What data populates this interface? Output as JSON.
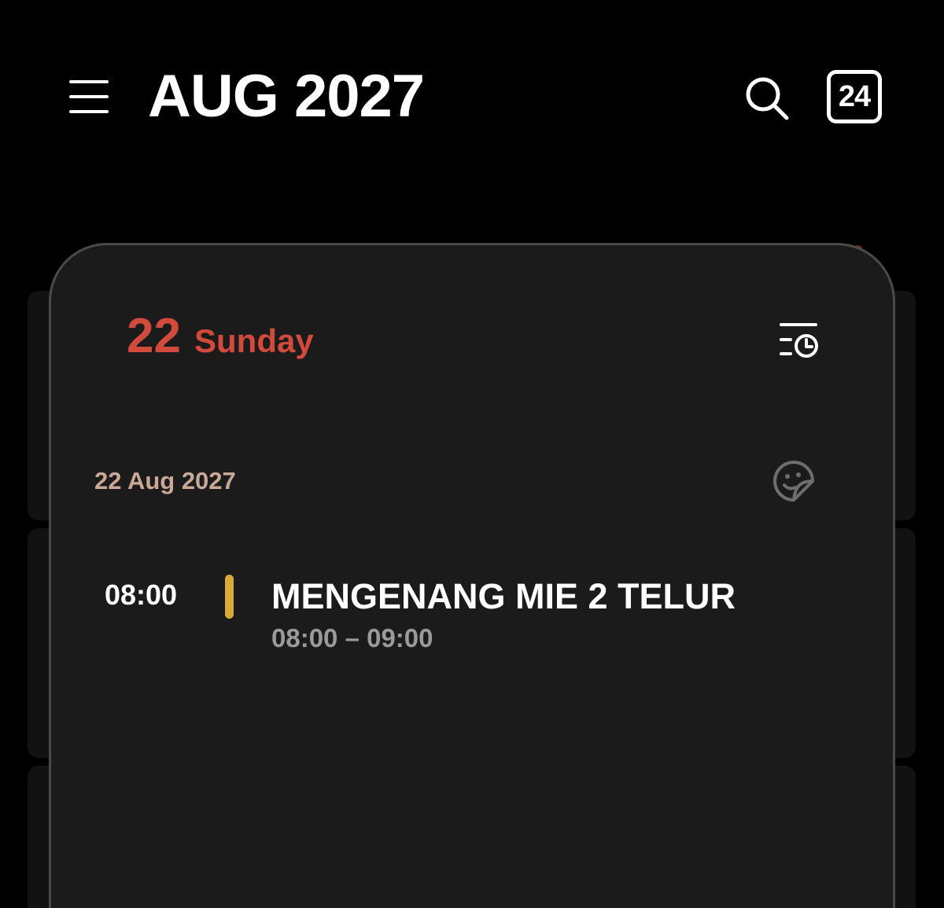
{
  "header": {
    "month_title": "AUG 2027",
    "today_number": "24"
  },
  "day_panel": {
    "day_number": "22",
    "day_name": "Sunday",
    "date_label": "22 Aug 2027",
    "events": [
      {
        "start": "08:00",
        "title": "MENGENANG MIE 2 TELUR",
        "range": "08:00 – 09:00",
        "color": "#d9a93a"
      }
    ]
  },
  "colors": {
    "accent_red": "#d24a3c",
    "panel_bg": "#1b1b1c",
    "date_label": "#c9a898"
  },
  "icons": {
    "menu": "hamburger-menu-icon",
    "search": "search-icon",
    "today": "calendar-today-icon",
    "schedule": "list-clock-icon",
    "sticker": "sticker-smiley-icon"
  }
}
